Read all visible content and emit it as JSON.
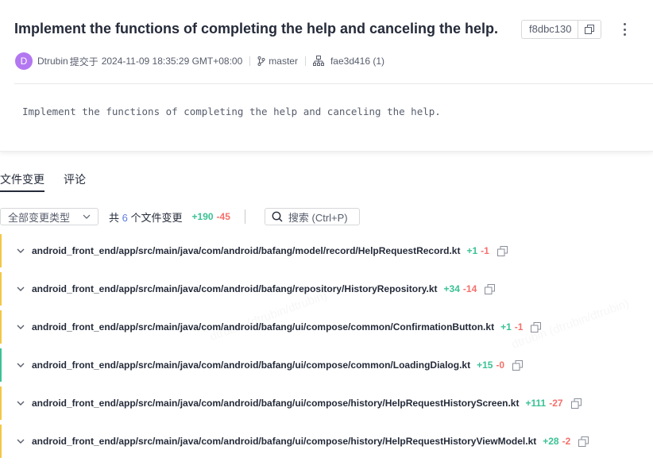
{
  "commit": {
    "title": "Implement the functions of completing the help and canceling the help.",
    "hash": "f8dbc130",
    "author_initial": "D",
    "author": "Dtrubin",
    "submitted_label": "提交于",
    "timestamp": "2024-11-09 18:35:29 GMT+08:00",
    "branch": "master",
    "parent": "fae3d416 (1)",
    "message": "Implement the functions of completing the help and canceling the help."
  },
  "tabs": [
    {
      "label": "文件变更",
      "active": true
    },
    {
      "label": "评论",
      "active": false
    }
  ],
  "toolbar": {
    "type_filter": "全部变更类型",
    "summary_prefix": "共",
    "file_count": "6",
    "summary_suffix": "个文件变更",
    "additions": "+190",
    "deletions": "-45",
    "search_placeholder": "搜索 (Ctrl+P)"
  },
  "files": [
    {
      "path": "android_front_end/app/src/main/java/com/android/bafang/model/record/HelpRequestRecord.kt",
      "additions": "+1",
      "deletions": "-1",
      "status_color": "#f3c745"
    },
    {
      "path": "android_front_end/app/src/main/java/com/android/bafang/repository/HistoryRepository.kt",
      "additions": "+34",
      "deletions": "-14",
      "status_color": "#f3c745"
    },
    {
      "path": "android_front_end/app/src/main/java/com/android/bafang/ui/compose/common/ConfirmationButton.kt",
      "additions": "+1",
      "deletions": "-1",
      "status_color": "#f3c745"
    },
    {
      "path": "android_front_end/app/src/main/java/com/android/bafang/ui/compose/common/LoadingDialog.kt",
      "additions": "+15",
      "deletions": "-0",
      "status_color": "#3ac295"
    },
    {
      "path": "android_front_end/app/src/main/java/com/android/bafang/ui/compose/history/HelpRequestHistoryScreen.kt",
      "additions": "+111",
      "deletions": "-27",
      "status_color": "#f3c745"
    },
    {
      "path": "android_front_end/app/src/main/java/com/android/bafang/ui/compose/history/HelpRequestHistoryViewModel.kt",
      "additions": "+28",
      "deletions": "-2",
      "status_color": "#f3c745"
    }
  ],
  "colors": {
    "added": "#3ac295",
    "deleted": "#f66f6a",
    "modified": "#f3c745",
    "avatar": "#b377f1",
    "accent": "#5e7ce0"
  },
  "icons": {
    "copy": "copy-icon",
    "more": "more-vertical-icon",
    "branch": "branch-icon",
    "commit": "commit-tree-icon",
    "chevron": "chevron-down-icon",
    "search": "search-icon"
  }
}
